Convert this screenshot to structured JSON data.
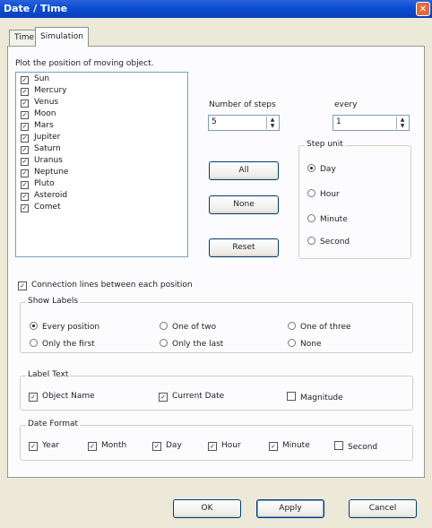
{
  "window": {
    "title": "Date / Time",
    "close_icon": "close-icon"
  },
  "tabs": [
    {
      "label": "Time",
      "active": false
    },
    {
      "label": "Simulation",
      "active": true
    }
  ],
  "plot_label": "Plot the position of moving object.",
  "objects": [
    {
      "label": "Sun",
      "checked": true
    },
    {
      "label": "Mercury",
      "checked": true
    },
    {
      "label": "Venus",
      "checked": true
    },
    {
      "label": "Moon",
      "checked": true
    },
    {
      "label": "Mars",
      "checked": true
    },
    {
      "label": "Jupiter",
      "checked": true
    },
    {
      "label": "Saturn",
      "checked": true
    },
    {
      "label": "Uranus",
      "checked": true
    },
    {
      "label": "Neptune",
      "checked": true
    },
    {
      "label": "Pluto",
      "checked": true
    },
    {
      "label": "Asteroid",
      "checked": true
    },
    {
      "label": "Comet",
      "checked": true
    }
  ],
  "steps": {
    "label": "Number of steps",
    "value": "5"
  },
  "every": {
    "label": "every",
    "value": "1"
  },
  "buttons": {
    "all": "All",
    "none": "None",
    "reset": "Reset",
    "ok": "OK",
    "apply": "Apply",
    "cancel": "Cancel"
  },
  "step_unit": {
    "title": "Step unit",
    "options": [
      {
        "label": "Day",
        "selected": true
      },
      {
        "label": "Hour",
        "selected": false
      },
      {
        "label": "Minute",
        "selected": false
      },
      {
        "label": "Second",
        "selected": false
      }
    ]
  },
  "connection_lines": {
    "label": "Connection lines between each position",
    "checked": true
  },
  "show_labels": {
    "title": "Show Labels",
    "options": [
      {
        "label": "Every position",
        "selected": true
      },
      {
        "label": "One of two",
        "selected": false
      },
      {
        "label": "One of three",
        "selected": false
      },
      {
        "label": "Only the first",
        "selected": false
      },
      {
        "label": "Only the last",
        "selected": false
      },
      {
        "label": "None",
        "selected": false
      }
    ]
  },
  "label_text": {
    "title": "Label Text",
    "options": [
      {
        "label": "Object Name",
        "checked": true
      },
      {
        "label": "Current Date",
        "checked": true
      },
      {
        "label": "Magnitude",
        "checked": false
      }
    ]
  },
  "date_format": {
    "title": "Date Format",
    "options": [
      {
        "label": "Year",
        "checked": true
      },
      {
        "label": "Month",
        "checked": true
      },
      {
        "label": "Day",
        "checked": true
      },
      {
        "label": "Hour",
        "checked": true
      },
      {
        "label": "Minute",
        "checked": true
      },
      {
        "label": "Second",
        "checked": false
      }
    ]
  },
  "colors": {
    "title_bar": "#0c4fd4",
    "dialog_bg": "#ece9d8",
    "panel_bg": "#fcfcfe"
  }
}
